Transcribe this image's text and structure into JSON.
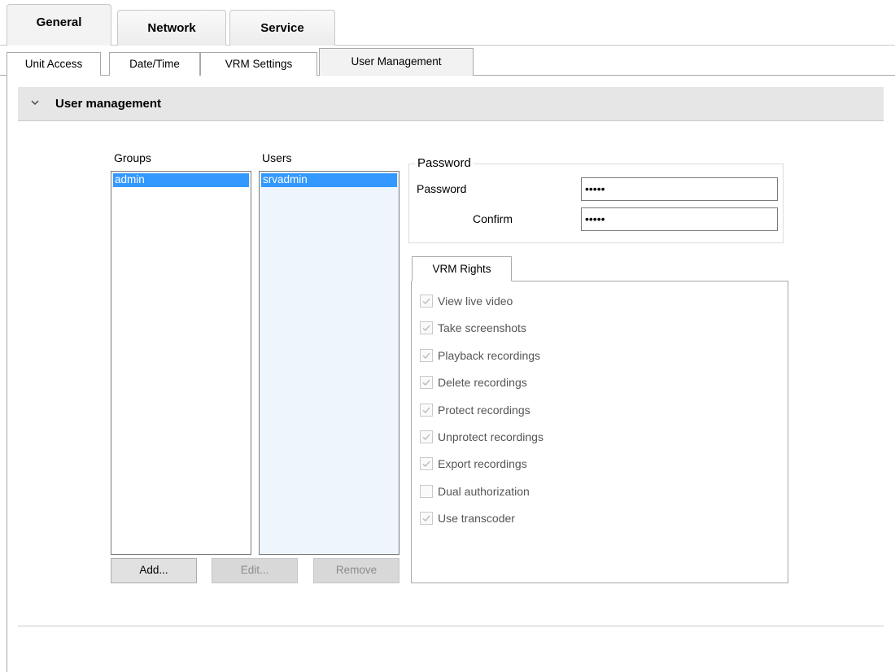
{
  "top_tabs": [
    {
      "label": "General",
      "active": true
    },
    {
      "label": "Network",
      "active": false
    },
    {
      "label": "Service",
      "active": false
    }
  ],
  "sub_tabs": [
    {
      "label": "Unit Access",
      "active": false
    },
    {
      "label": "Date/Time",
      "active": false
    },
    {
      "label": "VRM Settings",
      "active": false
    },
    {
      "label": "User Management",
      "active": true
    }
  ],
  "section": {
    "title": "User management",
    "expand_icon": "chevron-down-icon"
  },
  "groups": {
    "label": "Groups",
    "items": [
      "admin"
    ],
    "selected": "admin"
  },
  "users": {
    "label": "Users",
    "items": [
      "srvadmin"
    ],
    "selected": "srvadmin"
  },
  "password": {
    "group_label": "Password",
    "password_label": "Password",
    "password_value": "•••••",
    "confirm_label": "Confirm",
    "confirm_value": "•••••"
  },
  "vrm_rights": {
    "tab_label": "VRM Rights",
    "items": [
      {
        "label": "View live video",
        "checked": true
      },
      {
        "label": "Take screenshots",
        "checked": true
      },
      {
        "label": "Playback recordings",
        "checked": true
      },
      {
        "label": "Delete recordings",
        "checked": true
      },
      {
        "label": "Protect recordings",
        "checked": true
      },
      {
        "label": "Unprotect recordings",
        "checked": true
      },
      {
        "label": "Export recordings",
        "checked": true
      },
      {
        "label": "Dual authorization",
        "checked": false
      },
      {
        "label": "Use transcoder",
        "checked": true
      }
    ]
  },
  "buttons": {
    "add": {
      "label": "Add...",
      "enabled": true
    },
    "edit": {
      "label": "Edit...",
      "enabled": false
    },
    "remove": {
      "label": "Remove",
      "enabled": false
    }
  },
  "colors": {
    "selection": "#3399ff",
    "users_list_bg": "#eef5fd",
    "section_header_bg": "#e6e6e6"
  }
}
